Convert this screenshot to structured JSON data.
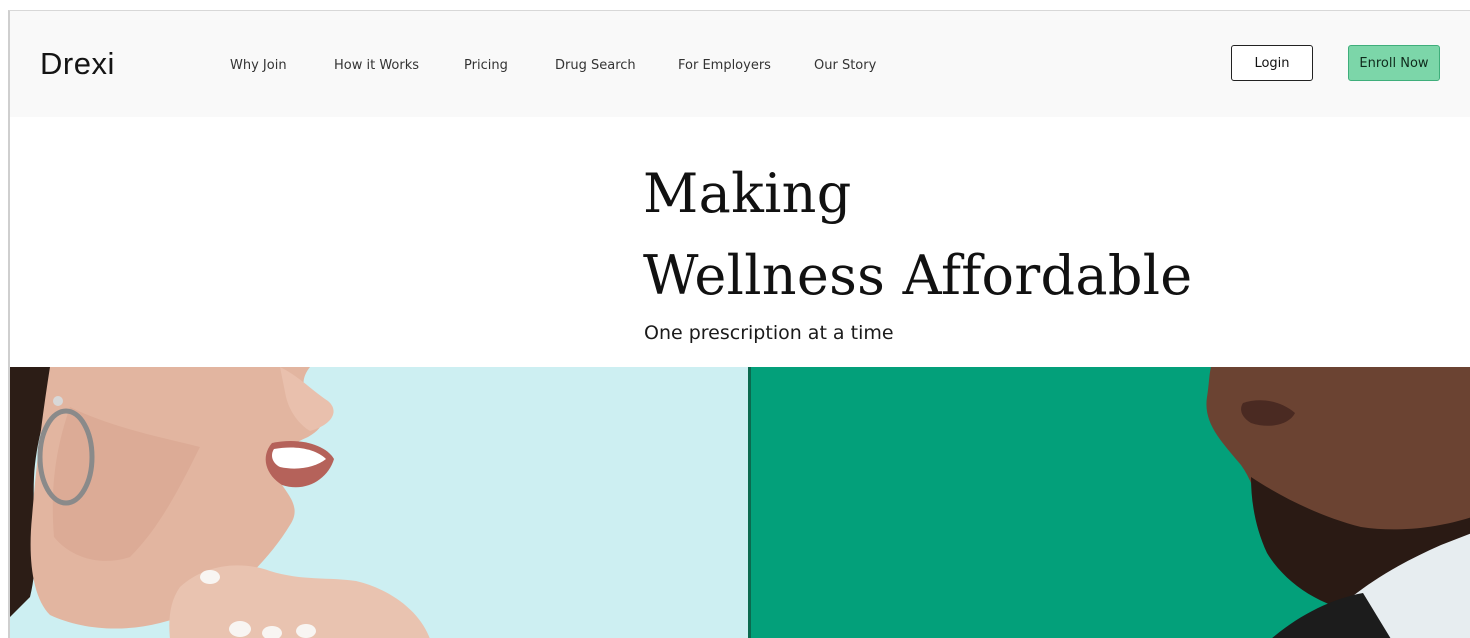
{
  "brand": {
    "logo_text": "Drexi"
  },
  "nav": {
    "links": [
      {
        "label": "Why Join"
      },
      {
        "label": "How it Works"
      },
      {
        "label": "Pricing"
      },
      {
        "label": "Drug Search"
      },
      {
        "label": "For Employers"
      },
      {
        "label": "Our Story"
      }
    ],
    "login_label": "Login",
    "enroll_label": "Enroll Now"
  },
  "hero": {
    "title_line1": "Making",
    "title_line2": "Wellness Affordable",
    "subtitle": "One prescription at a time"
  },
  "colors": {
    "nav_bg": "#f9f9f9",
    "enroll_bg": "#7cd6a9",
    "left_panel_bg": "#cdeff2",
    "right_panel_bg": "#03a07a"
  },
  "images": {
    "left": "smiling-woman-photo",
    "right": "smiling-man-photo"
  }
}
